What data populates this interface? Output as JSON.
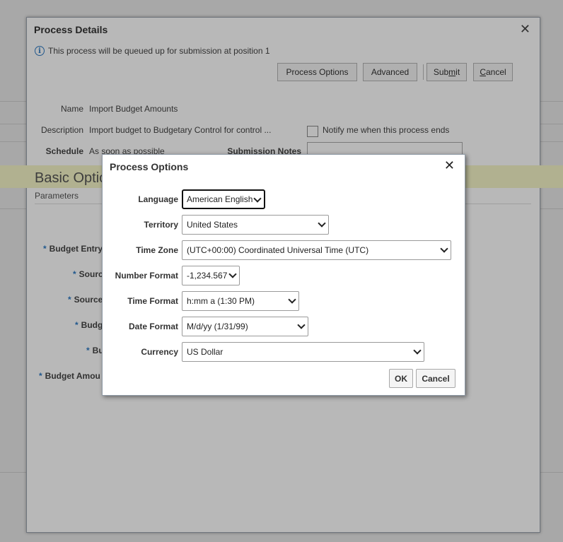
{
  "outer": {
    "title": "Process Details",
    "info": "This process will be queued up for submission at position 1",
    "buttons": {
      "process_options": "Process Options",
      "advanced": "Advanced",
      "submit_pre": "Sub",
      "submit_mn": "m",
      "submit_post": "it",
      "cancel_mn": "C",
      "cancel_post": "ancel"
    },
    "fields": {
      "name_label": "Name",
      "name_value": "Import Budget Amounts",
      "description_label": "Description",
      "description_value": "Import budget to Budgetary Control for control ...",
      "schedule_label": "Schedule",
      "schedule_value": "As soon as possible",
      "notify_label": "Notify me when this process ends",
      "notes_label": "Submission Notes"
    },
    "section_title": "Basic Options",
    "section_sub": "Parameters",
    "params": [
      "Budget Entry",
      "Source",
      "Source",
      "Budg",
      "Bu",
      "Budget Amou"
    ]
  },
  "modal": {
    "title": "Process Options",
    "fields": [
      {
        "label": "Language",
        "value": "American English"
      },
      {
        "label": "Territory",
        "value": "United States"
      },
      {
        "label": "Time Zone",
        "value": "(UTC+00:00) Coordinated Universal Time (UTC)"
      },
      {
        "label": "Number Format",
        "value": "-1,234.567"
      },
      {
        "label": "Time Format",
        "value": "h:mm a (1:30 PM)"
      },
      {
        "label": "Date Format",
        "value": "M/d/yy (1/31/99)"
      },
      {
        "label": "Currency",
        "value": "US Dollar"
      }
    ],
    "ok_label": "OK",
    "cancel_label": "Cancel"
  }
}
